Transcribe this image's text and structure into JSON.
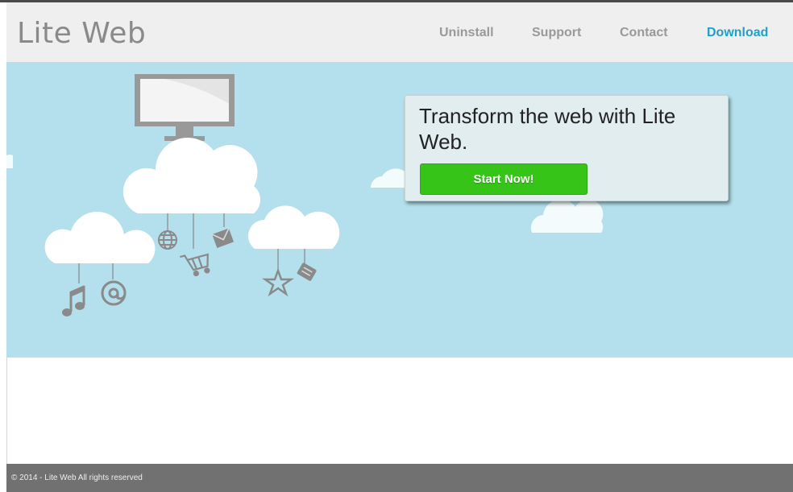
{
  "header": {
    "logo": "Lite Web",
    "nav": [
      {
        "label": "Uninstall"
      },
      {
        "label": "Support"
      },
      {
        "label": "Contact"
      },
      {
        "label": "Download"
      }
    ]
  },
  "hero": {
    "headline": "Transform the web with Lite Web.",
    "cta_label": "Start Now!",
    "icons": [
      "monitor-icon",
      "globe-icon",
      "envelope-icon",
      "shopping-cart-icon",
      "music-note-icon",
      "at-sign-icon",
      "star-icon",
      "tag-icon"
    ]
  },
  "footer": {
    "copyright": "© 2014 - Lite Web All rights reserved"
  },
  "colors": {
    "hero_bg": "#b3e0ec",
    "accent": "#1ea0c8",
    "cta_green": "#36c419",
    "footer_bg": "#717171"
  }
}
